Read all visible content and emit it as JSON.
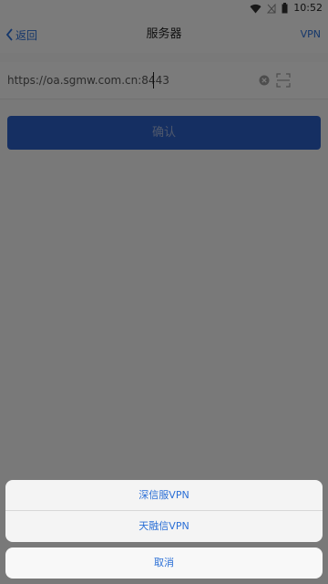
{
  "status_bar": {
    "time": "10:52",
    "icons": [
      "wifi-icon",
      "no-signal-icon",
      "battery-icon"
    ]
  },
  "nav": {
    "back_label": "返回",
    "title": "服务器",
    "vpn_label": "VPN"
  },
  "server": {
    "value": "https://oa.sgmw.com.cn:8443",
    "icons": [
      "clear-icon",
      "scan-icon"
    ]
  },
  "confirm_label": "确认",
  "action_sheet": {
    "options": [
      "深信服VPN",
      "天融信VPN"
    ],
    "cancel_label": "取消"
  },
  "colors": {
    "accent": "#2b6fd6",
    "button": "#2b5fc5",
    "background": "#f2f2f2"
  }
}
